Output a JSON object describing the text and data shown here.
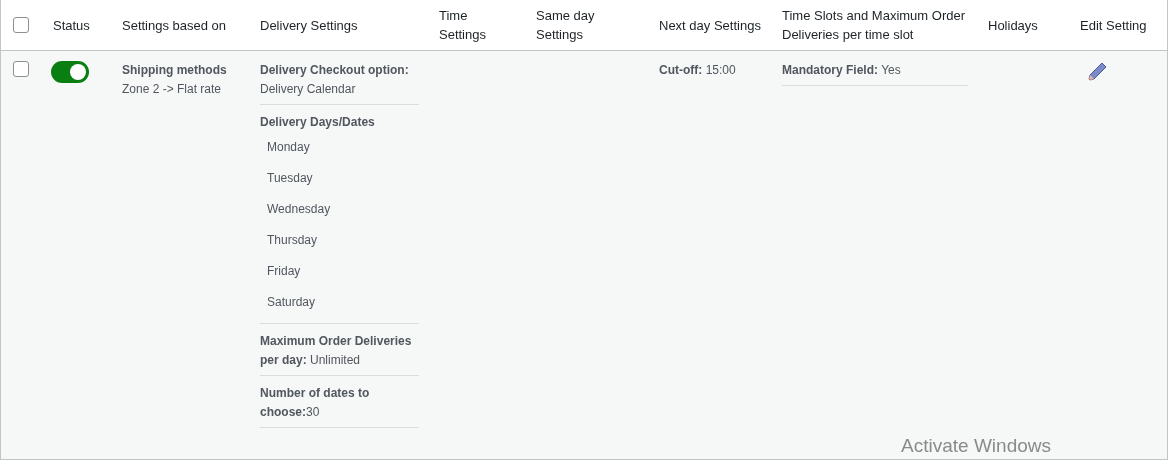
{
  "table": {
    "select_all": {
      "checked": false
    },
    "columns": [
      {
        "label": "Status"
      },
      {
        "label": "Settings based on"
      },
      {
        "label": "Delivery Settings"
      },
      {
        "label": "Time Settings"
      },
      {
        "label": "Same day Settings"
      },
      {
        "label": "Next day Settings"
      },
      {
        "label": "Time Slots and Maximum Order Deliveries per time slot"
      },
      {
        "label": "Holidays"
      },
      {
        "label": "Edit Setting"
      }
    ],
    "rows": [
      {
        "checked": false,
        "status_on": true,
        "settings_based_on": {
          "title": "Shipping methods",
          "detail": "Zone 2 -> Flat rate"
        },
        "delivery_settings": [
          {
            "kind": "field",
            "text": "**Delivery Checkout option:** Delivery Calendar"
          },
          {
            "kind": "list",
            "title": "Delivery Days/Dates",
            "items": [
              "Monday",
              "Tuesday",
              "Wednesday",
              "Thursday",
              "Friday",
              "Saturday"
            ]
          },
          {
            "kind": "field",
            "text": "**Maximum Order Deliveries per day:** Unlimited"
          },
          {
            "kind": "field",
            "text": "**Number of dates to choose:**30"
          }
        ],
        "next_day_settings": "**Cut-off:** 15:00",
        "time_slots": "**Mandatory Field:** Yes"
      }
    ]
  },
  "watermark": "Activate Windows"
}
